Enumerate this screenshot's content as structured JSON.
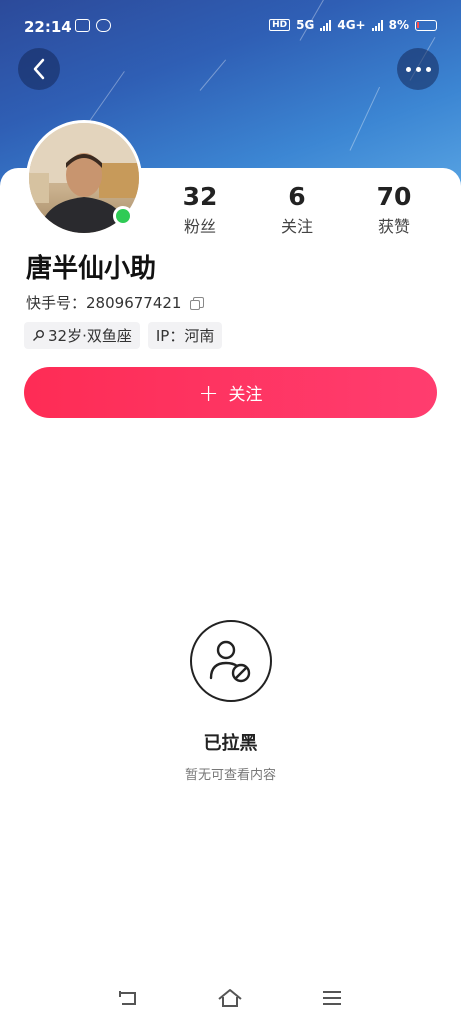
{
  "status_bar": {
    "time": "22:14",
    "network_1": "5G",
    "network_2": "4G+",
    "battery": "8%"
  },
  "profile": {
    "name": "唐半仙小助",
    "kuaishou_id_label": "快手号：",
    "kuaishou_id": "2809677421",
    "stats": [
      {
        "value": "32",
        "label": "粉丝"
      },
      {
        "value": "6",
        "label": "关注"
      },
      {
        "value": "70",
        "label": "获赞"
      }
    ],
    "tags": {
      "age_constellation": "32岁·双鱼座",
      "ip": "IP：河南"
    },
    "online": true
  },
  "follow_button": {
    "plus": "+",
    "label": "关注"
  },
  "blocked": {
    "title": "已拉黑",
    "subtitle": "暂无可查看内容"
  },
  "colors": {
    "accent": "#fe2c55",
    "header_top": "#2c4a9a",
    "header_bottom": "#5aa6e4",
    "online": "#2fcb55"
  },
  "icons": [
    "back-icon",
    "more-icon",
    "copy-icon",
    "gender-icon",
    "blocked-user-icon",
    "nav-back-icon",
    "nav-home-icon",
    "nav-menu-icon"
  ]
}
